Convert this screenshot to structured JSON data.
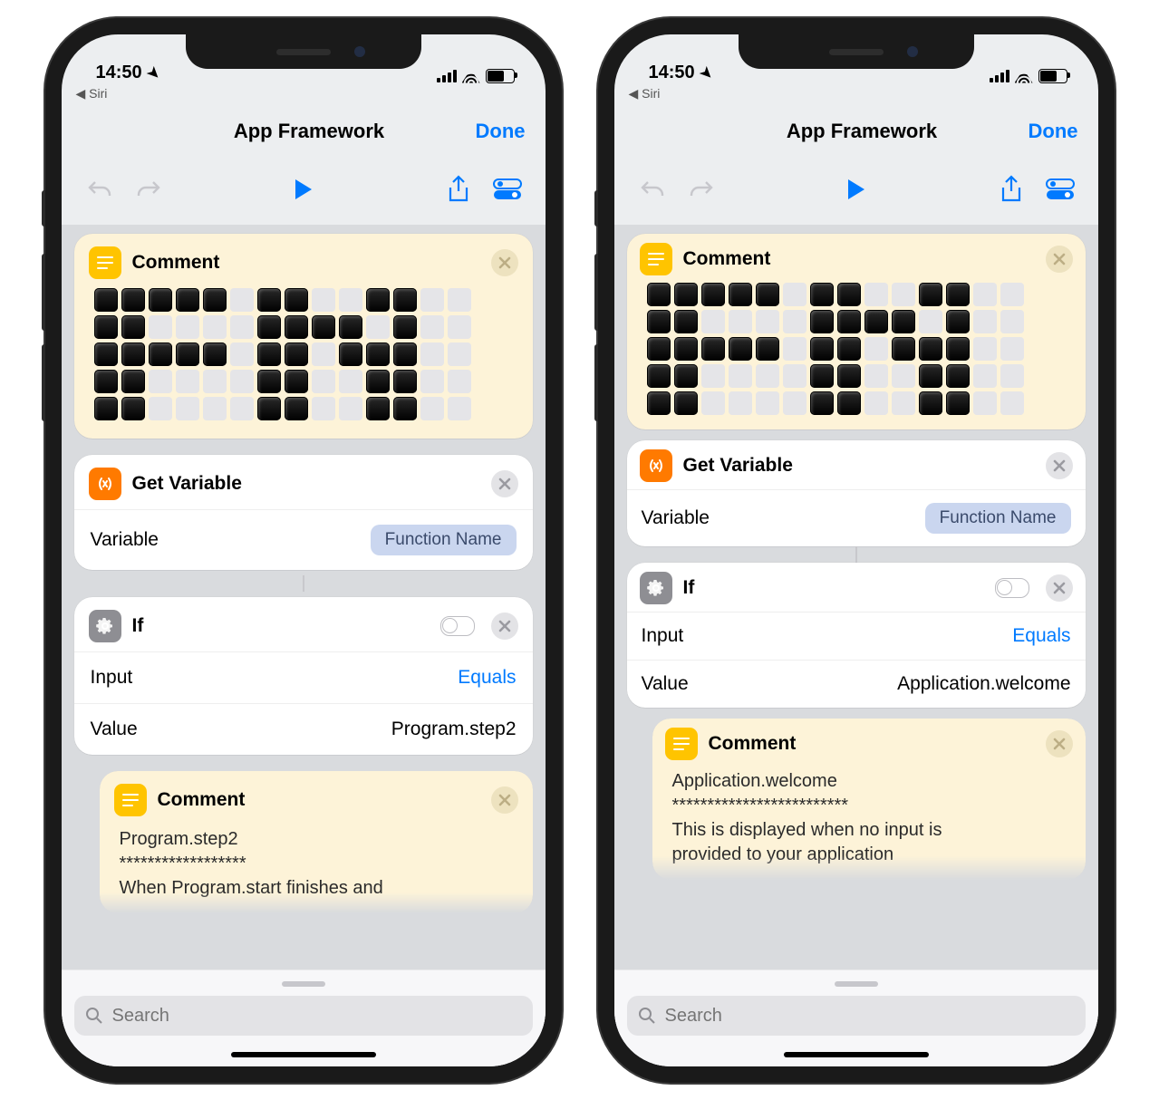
{
  "status": {
    "time": "14:50",
    "back_app": "Siri"
  },
  "nav": {
    "title": "App Framework",
    "done": "Done"
  },
  "colors": {
    "accent": "#007aff"
  },
  "search": {
    "placeholder": "Search"
  },
  "phones": [
    {
      "cards": {
        "comment_top": {
          "title": "Comment"
        },
        "get_var": {
          "title": "Get Variable",
          "param_label": "Variable",
          "pill": "Function Name"
        },
        "if": {
          "title": "If",
          "input_label": "Input",
          "input_value": "Equals",
          "value_label": "Value",
          "value_value": "Program.step2"
        },
        "comment_body": {
          "title": "Comment",
          "line1": "Program.step2",
          "line2": "******************",
          "line3": "When Program.start finishes and"
        }
      }
    },
    {
      "cards": {
        "comment_top": {
          "title": "Comment"
        },
        "get_var": {
          "title": "Get Variable",
          "param_label": "Variable",
          "pill": "Function Name"
        },
        "if": {
          "title": "If",
          "input_label": "Input",
          "input_value": "Equals",
          "value_label": "Value",
          "value_value": "Application.welcome"
        },
        "comment_body": {
          "title": "Comment",
          "line1": "Application.welcome",
          "line2": "*************************",
          "line3": "This is displayed when no input is",
          "line4": "provided to your application"
        }
      }
    }
  ],
  "pixel_art": [
    "11111.11..11..",
    "11....1111.1..",
    "11111.11.111..",
    "11....11..11..",
    "11....11..11.."
  ]
}
